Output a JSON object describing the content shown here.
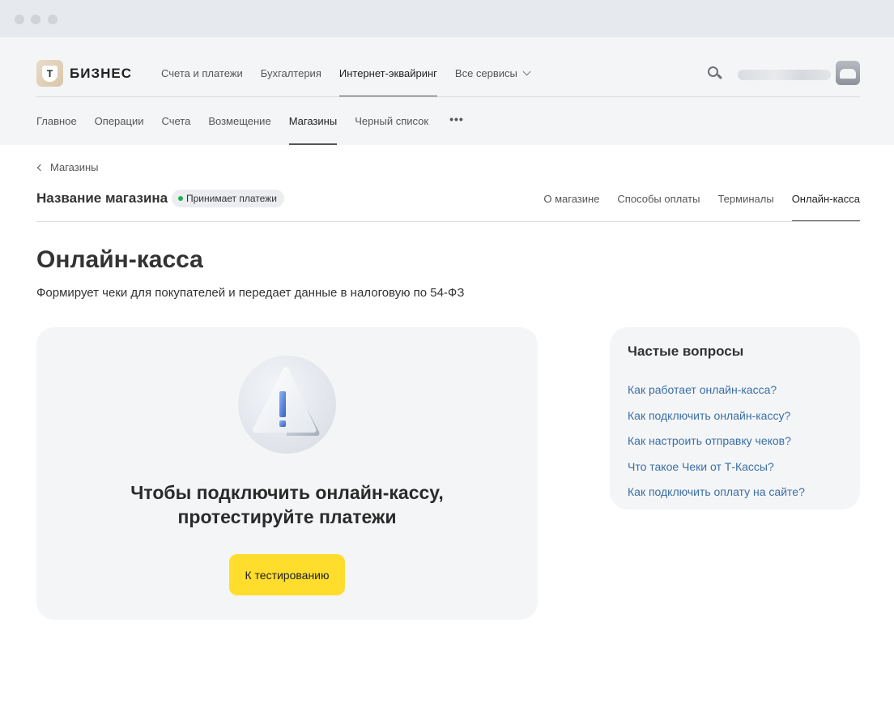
{
  "header": {
    "logo_text": "БИЗНЕС",
    "logo_letter": "Т",
    "topnav": [
      {
        "label": "Счета и платежи"
      },
      {
        "label": "Бухгалтерия"
      },
      {
        "label": "Интернет-эквайринг",
        "active": true
      },
      {
        "label": "Все сервисы"
      }
    ],
    "subnav": [
      {
        "label": "Главное"
      },
      {
        "label": "Операции"
      },
      {
        "label": "Счета"
      },
      {
        "label": "Возмещение"
      },
      {
        "label": "Магазины",
        "active": true
      },
      {
        "label": "Черный список"
      }
    ],
    "more_label": "•••"
  },
  "breadcrumb": {
    "label": "Магазины"
  },
  "store": {
    "title": "Название магазина",
    "status": "Принимает платежи",
    "status_color": "#21b04b",
    "tabs": [
      {
        "label": "О магазине"
      },
      {
        "label": "Способы оплаты"
      },
      {
        "label": "Терминалы"
      },
      {
        "label": "Онлайн-касса",
        "active": true
      }
    ]
  },
  "page": {
    "title": "Онлайн-касса",
    "description": "Формирует чеки для покупателей и передает данные в налоговую по 54-ФЗ"
  },
  "main_card": {
    "icon": "warning-icon",
    "heading_line1": "Чтобы подключить онлайн-кассу,",
    "heading_line2": "протестируйте платежи",
    "button_label": "К тестированию",
    "button_color": "#ffdd2d"
  },
  "faq": {
    "title": "Частые вопросы",
    "links": [
      "Как работает онлайн-касса?",
      "Как подключить онлайн-кассу?",
      "Как настроить отправку чеков?",
      "Что такое Чеки от Т-Кассы?",
      "Как подключить оплату на сайте?"
    ],
    "link_color": "#3a6ea5"
  }
}
